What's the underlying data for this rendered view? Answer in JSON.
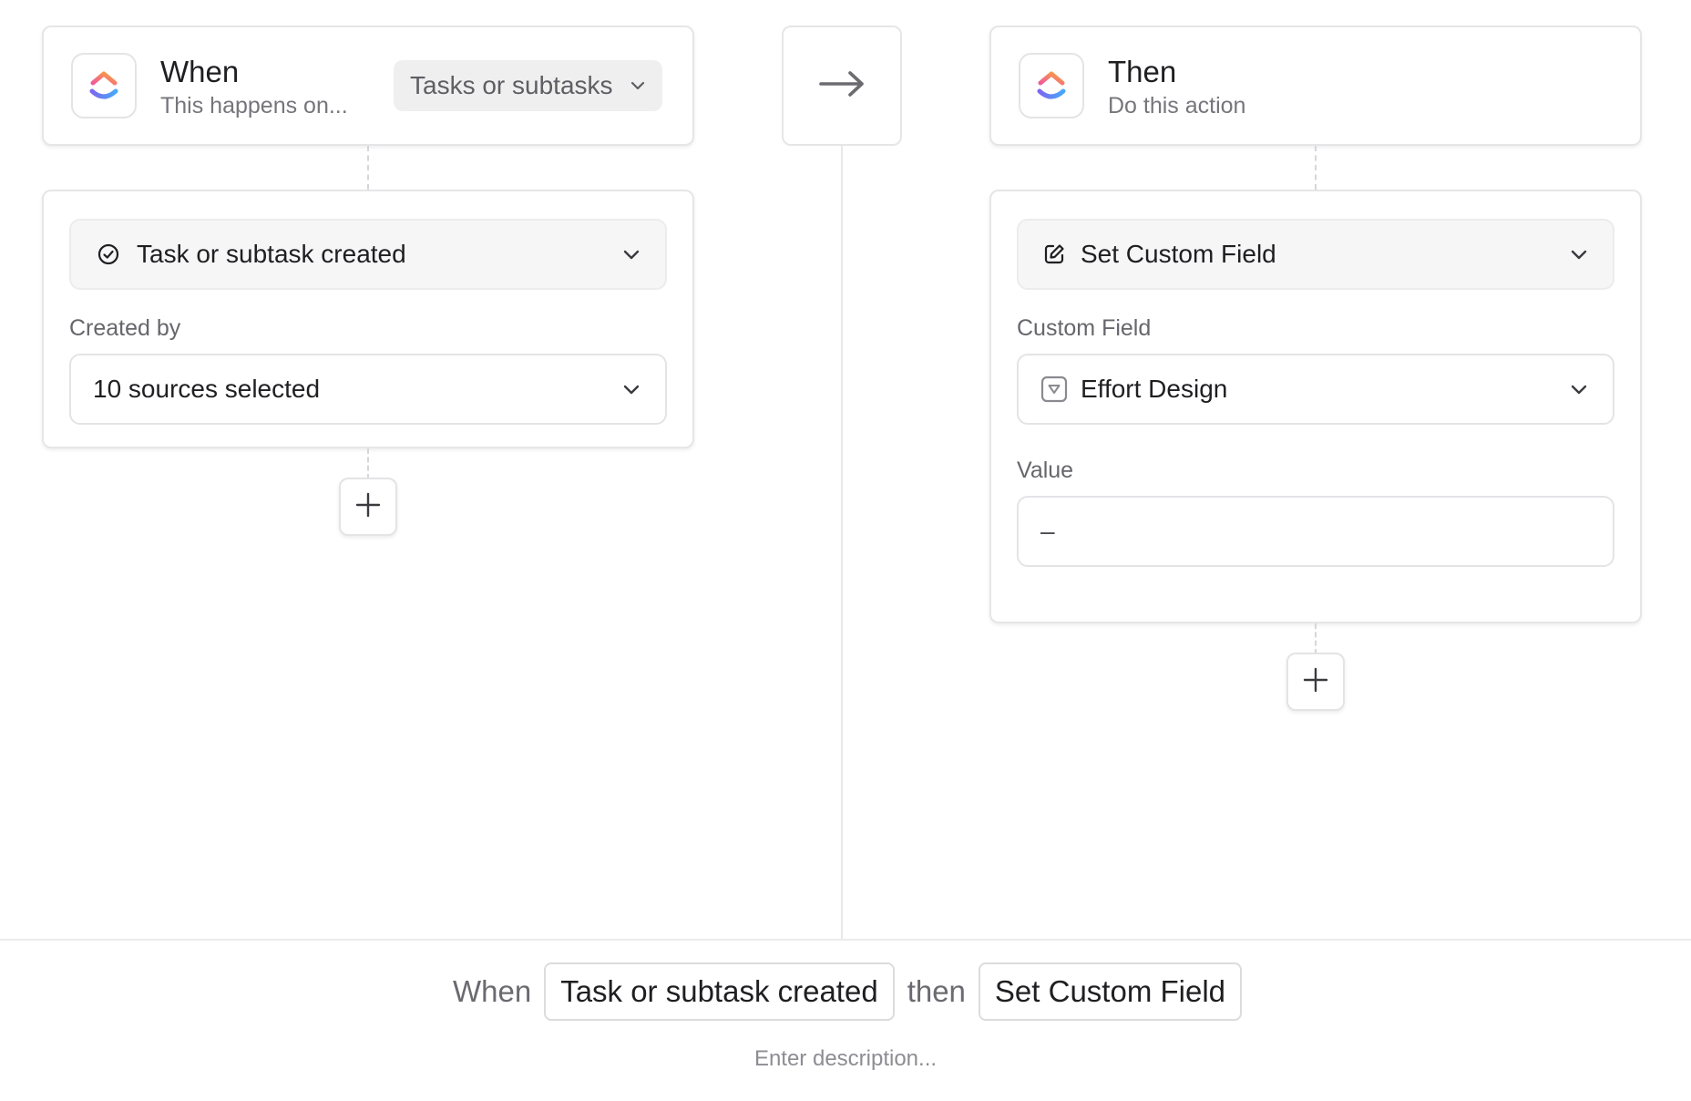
{
  "trigger": {
    "title": "When",
    "subtitle": "This happens on...",
    "scope_label": "Tasks or subtasks",
    "event_label": "Task or subtask created",
    "created_by_label": "Created by",
    "created_by_value": "10 sources selected"
  },
  "action": {
    "title": "Then",
    "subtitle": "Do this action",
    "action_label": "Set Custom Field",
    "custom_field_label": "Custom Field",
    "custom_field_value": "Effort Design",
    "value_label": "Value",
    "value_text": "–"
  },
  "summary": {
    "when_word": "When",
    "trigger_pill": "Task or subtask created",
    "then_word": "then",
    "action_pill": "Set Custom Field",
    "description_placeholder": "Enter description..."
  },
  "icons": {
    "logo": "clickup-logo-icon",
    "arrow": "arrow-right-icon",
    "chevron": "chevron-down-icon",
    "check": "check-circle-icon",
    "edit": "edit-icon",
    "dropdown_field": "dropdown-field-icon",
    "plus": "plus-icon"
  },
  "colors": {
    "logo_pink": "#f25a9b",
    "logo_orange": "#f7a23b",
    "logo_purple": "#7b68ee",
    "logo_blue": "#48a9f8"
  }
}
